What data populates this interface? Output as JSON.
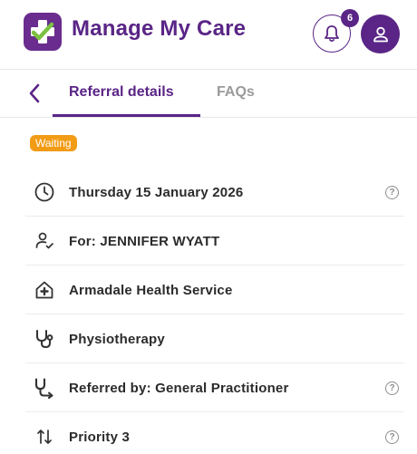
{
  "header": {
    "app_title": "Manage My Care",
    "notification_count": "6"
  },
  "tabs": {
    "items": [
      {
        "label": "Referral details",
        "active": true
      },
      {
        "label": "FAQs",
        "active": false
      }
    ]
  },
  "status": {
    "label": "Waiting",
    "color": "#f29b15"
  },
  "details": [
    {
      "icon": "clock-icon",
      "label": "Thursday 15 January 2026",
      "help": true
    },
    {
      "icon": "person-check-icon",
      "label": "For: JENNIFER WYATT",
      "help": false
    },
    {
      "icon": "hospital-icon",
      "label": "Armadale Health Service",
      "help": false
    },
    {
      "icon": "stethoscope-icon",
      "label": "Physiotherapy",
      "help": false
    },
    {
      "icon": "stethoscope-referral-icon",
      "label": "Referred by: General Practitioner",
      "help": true
    },
    {
      "icon": "priority-arrows-icon",
      "label": "Priority 3",
      "help": true
    }
  ],
  "help_glyph": "?",
  "colors": {
    "brand_purple": "#5a2586",
    "logo_green": "#7cc142",
    "status_orange": "#f29b15"
  }
}
